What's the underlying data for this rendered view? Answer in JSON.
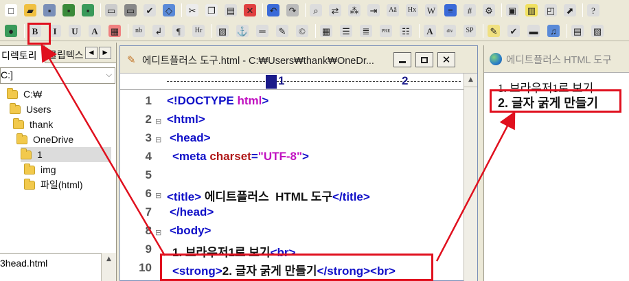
{
  "toolbar_row1": [
    {
      "icon": "new-file-icon",
      "glyph": "□",
      "color": "#ffffff"
    },
    {
      "icon": "open-folder-icon",
      "glyph": "▰",
      "color": "#f0c040"
    },
    {
      "icon": "save-icon",
      "glyph": "▪",
      "color": "#7a8fb8"
    },
    {
      "icon": "save-all-icon",
      "glyph": "▪",
      "color": "#3a8a3a"
    },
    {
      "icon": "save-as-icon",
      "glyph": "▪",
      "color": "#3a9a5a"
    },
    {
      "icon": "print-preview-icon",
      "glyph": "▭",
      "color": "#cccccc"
    },
    {
      "icon": "print-icon",
      "glyph": "▭",
      "color": "#888888"
    },
    {
      "icon": "spellcheck-icon",
      "glyph": "✔",
      "color": "#dddddd"
    },
    {
      "icon": "view-source-icon",
      "glyph": "◇",
      "color": "#5a8ad8"
    },
    {
      "icon": "cut-icon",
      "glyph": "✂",
      "color": "#ececec"
    },
    {
      "icon": "copy-icon",
      "glyph": "❐",
      "color": "#ececec"
    },
    {
      "icon": "paste-icon",
      "glyph": "▤",
      "color": "#dddddd"
    },
    {
      "icon": "delete-icon",
      "glyph": "✕",
      "color": "#e04040"
    },
    {
      "icon": "undo-icon",
      "glyph": "↶",
      "color": "#3a6ad8"
    },
    {
      "icon": "redo-icon",
      "glyph": "↷",
      "color": "#bbbbbb"
    },
    {
      "icon": "find-icon",
      "glyph": "⌕",
      "color": "#dddddd"
    },
    {
      "icon": "replace-icon",
      "glyph": "⇄",
      "color": "#dddddd"
    },
    {
      "icon": "goto-line-icon",
      "glyph": "⁂",
      "color": "#dddddd"
    },
    {
      "icon": "indent-icon",
      "glyph": "⇥",
      "color": "#dddddd"
    },
    {
      "icon": "font-size-icon",
      "glyph": "Aǎ",
      "color": "#dddddd"
    },
    {
      "icon": "heading-icon",
      "glyph": "Hx",
      "color": "#dddddd"
    },
    {
      "icon": "word-wrap-icon",
      "glyph": "W",
      "color": "#dddddd"
    },
    {
      "icon": "line-spacing-icon",
      "glyph": "≡",
      "color": "#3a6ad8"
    },
    {
      "icon": "line-numbers-icon",
      "glyph": "#",
      "color": "#dddddd"
    },
    {
      "icon": "settings-icon",
      "glyph": "⚙",
      "color": "#dddddd"
    },
    {
      "icon": "panel-left-icon",
      "glyph": "▣",
      "color": "#dddddd"
    },
    {
      "icon": "panel-split-icon",
      "glyph": "▥",
      "color": "#f0e060"
    },
    {
      "icon": "preview-icon",
      "glyph": "◰",
      "color": "#dddddd"
    },
    {
      "icon": "external-browser-icon",
      "glyph": "⬈",
      "color": "#dddddd"
    },
    {
      "icon": "help-icon",
      "glyph": "?",
      "color": "#dddddd"
    }
  ],
  "toolbar_row2": [
    {
      "icon": "browser-globe-icon",
      "glyph": "●",
      "color": "#3a9a5a"
    },
    {
      "icon": "bold-icon",
      "glyph": "B",
      "color": "#dddddd"
    },
    {
      "icon": "italic-icon",
      "glyph": "I",
      "color": "#dddddd"
    },
    {
      "icon": "underline-icon",
      "glyph": "U",
      "color": "#dddddd"
    },
    {
      "icon": "font-color-icon",
      "glyph": "A",
      "color": "#dddddd"
    },
    {
      "icon": "color-palette-icon",
      "glyph": "▦",
      "color": "#f08080"
    },
    {
      "icon": "nobr-icon",
      "glyph": "nb",
      "color": "#dddddd"
    },
    {
      "icon": "line-break-icon",
      "glyph": "↲",
      "color": "#dddddd"
    },
    {
      "icon": "paragraph-icon",
      "glyph": "¶",
      "color": "#dddddd"
    },
    {
      "icon": "horizontal-rule-icon",
      "glyph": "Hr",
      "color": "#dddddd"
    },
    {
      "icon": "insert-image-icon",
      "glyph": "▨",
      "color": "#dddddd"
    },
    {
      "icon": "anchor-icon",
      "glyph": "⚓",
      "color": "#dddddd"
    },
    {
      "icon": "hr-line-icon",
      "glyph": "═",
      "color": "#dddddd"
    },
    {
      "icon": "form-edit-icon",
      "glyph": "✎",
      "color": "#dddddd"
    },
    {
      "icon": "special-char-icon",
      "glyph": "©",
      "color": "#dddddd"
    },
    {
      "icon": "table-icon",
      "glyph": "▦",
      "color": "#dddddd"
    },
    {
      "icon": "table-row-icon",
      "glyph": "☰",
      "color": "#dddddd"
    },
    {
      "icon": "align-center-icon",
      "glyph": "≣",
      "color": "#dddddd"
    },
    {
      "icon": "preformatted-icon",
      "glyph": "PRE",
      "color": "#dddddd"
    },
    {
      "icon": "list-icon",
      "glyph": "☷",
      "color": "#dddddd"
    },
    {
      "icon": "font-tag-icon",
      "glyph": "A",
      "color": "#dddddd"
    },
    {
      "icon": "div-tag-icon",
      "glyph": "div",
      "color": "#dddddd"
    },
    {
      "icon": "span-tag-icon",
      "glyph": "SP",
      "color": "#dddddd"
    },
    {
      "icon": "edit-pencil-icon",
      "glyph": "✎",
      "color": "#f0e080"
    },
    {
      "icon": "validate-icon",
      "glyph": "✔",
      "color": "#dddddd"
    },
    {
      "icon": "video-icon",
      "glyph": "▬",
      "color": "#dddddd"
    },
    {
      "icon": "audio-icon",
      "glyph": "♫",
      "color": "#5a8ad8"
    },
    {
      "icon": "frame-icon",
      "glyph": "▤",
      "color": "#dddddd"
    },
    {
      "icon": "template-icon",
      "glyph": "▧",
      "color": "#dddddd"
    }
  ],
  "left_panel": {
    "tab_explorer": "디렉토리",
    "tab_clipboard": "클립텍스",
    "drive": "C:]",
    "tree": [
      "C:₩",
      "Users",
      "thank",
      "OneDrive",
      "1",
      "img",
      "파일(html)"
    ],
    "file_item": "3head.html"
  },
  "editor": {
    "title": "에디트플러스 도구.html - C:₩Users₩thank₩OneDr...",
    "ruler_1": "1",
    "ruler_2": "2",
    "lines": [
      "1",
      "2",
      "3",
      "4",
      "5",
      "6",
      "7",
      "8",
      "9",
      "10"
    ],
    "code": {
      "l1_tag": "<!DOCTYPE ",
      "l1_kw": "html",
      "l1_end": ">",
      "l2": "<html>",
      "l3": "<head>",
      "l4_tag": "<meta ",
      "l4_attr": "charset",
      "l4_eq": "=",
      "l4_val": "\"UTF-8\"",
      "l4_end": ">",
      "l6_open": "<title>",
      "l6_text": " 에디트플러스  HTML 도구",
      "l6_close": "</title>",
      "l7": "</head>",
      "l8": "<body>",
      "l9_text": "1. 브라우저1로 보기",
      "l9_br": "<br>",
      "l10_open": "<strong>",
      "l10_text": "2. 글자 굵게 만들기",
      "l10_close": "</strong>",
      "l10_br": "<br>"
    }
  },
  "preview": {
    "title": "에디트플러스 HTML 도구",
    "line1": "1. 브라우저1로 보기",
    "line2": "2. 글자 굵게 만들기"
  },
  "annotation_color": "#e0101e"
}
